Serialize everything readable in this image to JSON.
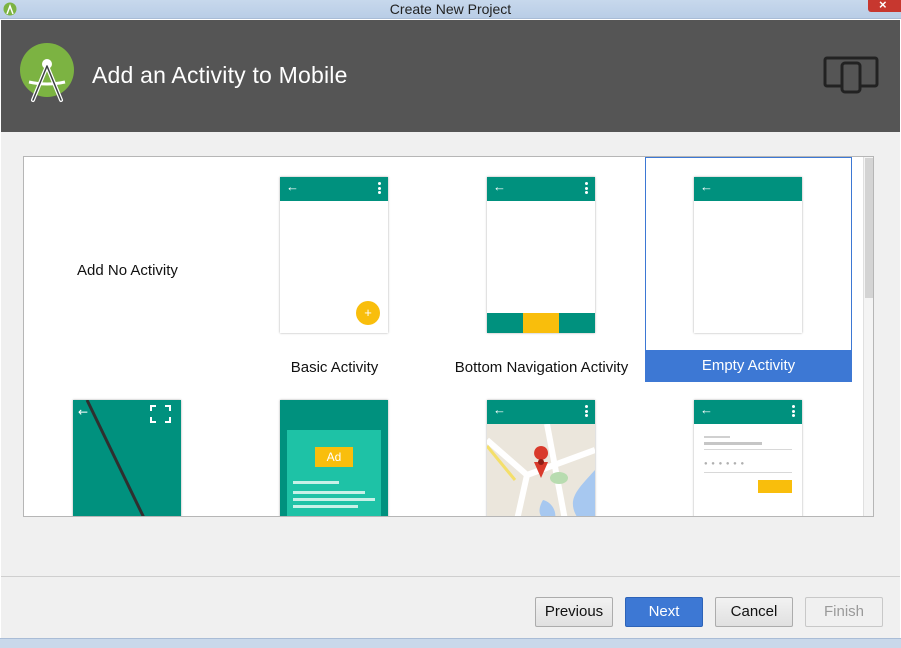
{
  "window": {
    "title": "Create New Project"
  },
  "header": {
    "heading": "Add an Activity to Mobile"
  },
  "gallery": {
    "activities": [
      {
        "label": "Add No Activity"
      },
      {
        "label": "Basic Activity"
      },
      {
        "label": "Bottom Navigation Activity"
      },
      {
        "label": "Empty Activity",
        "selected": true
      }
    ],
    "ad_badge": "Ad"
  },
  "footer": {
    "previous_label": "Previous",
    "next_label": "Next",
    "cancel_label": "Cancel",
    "finish_label": "Finish"
  },
  "colors": {
    "header_bg": "#555555",
    "template_teal": "#00917e",
    "accent_yellow": "#f9be0c",
    "selection_blue": "#3d78d4"
  }
}
